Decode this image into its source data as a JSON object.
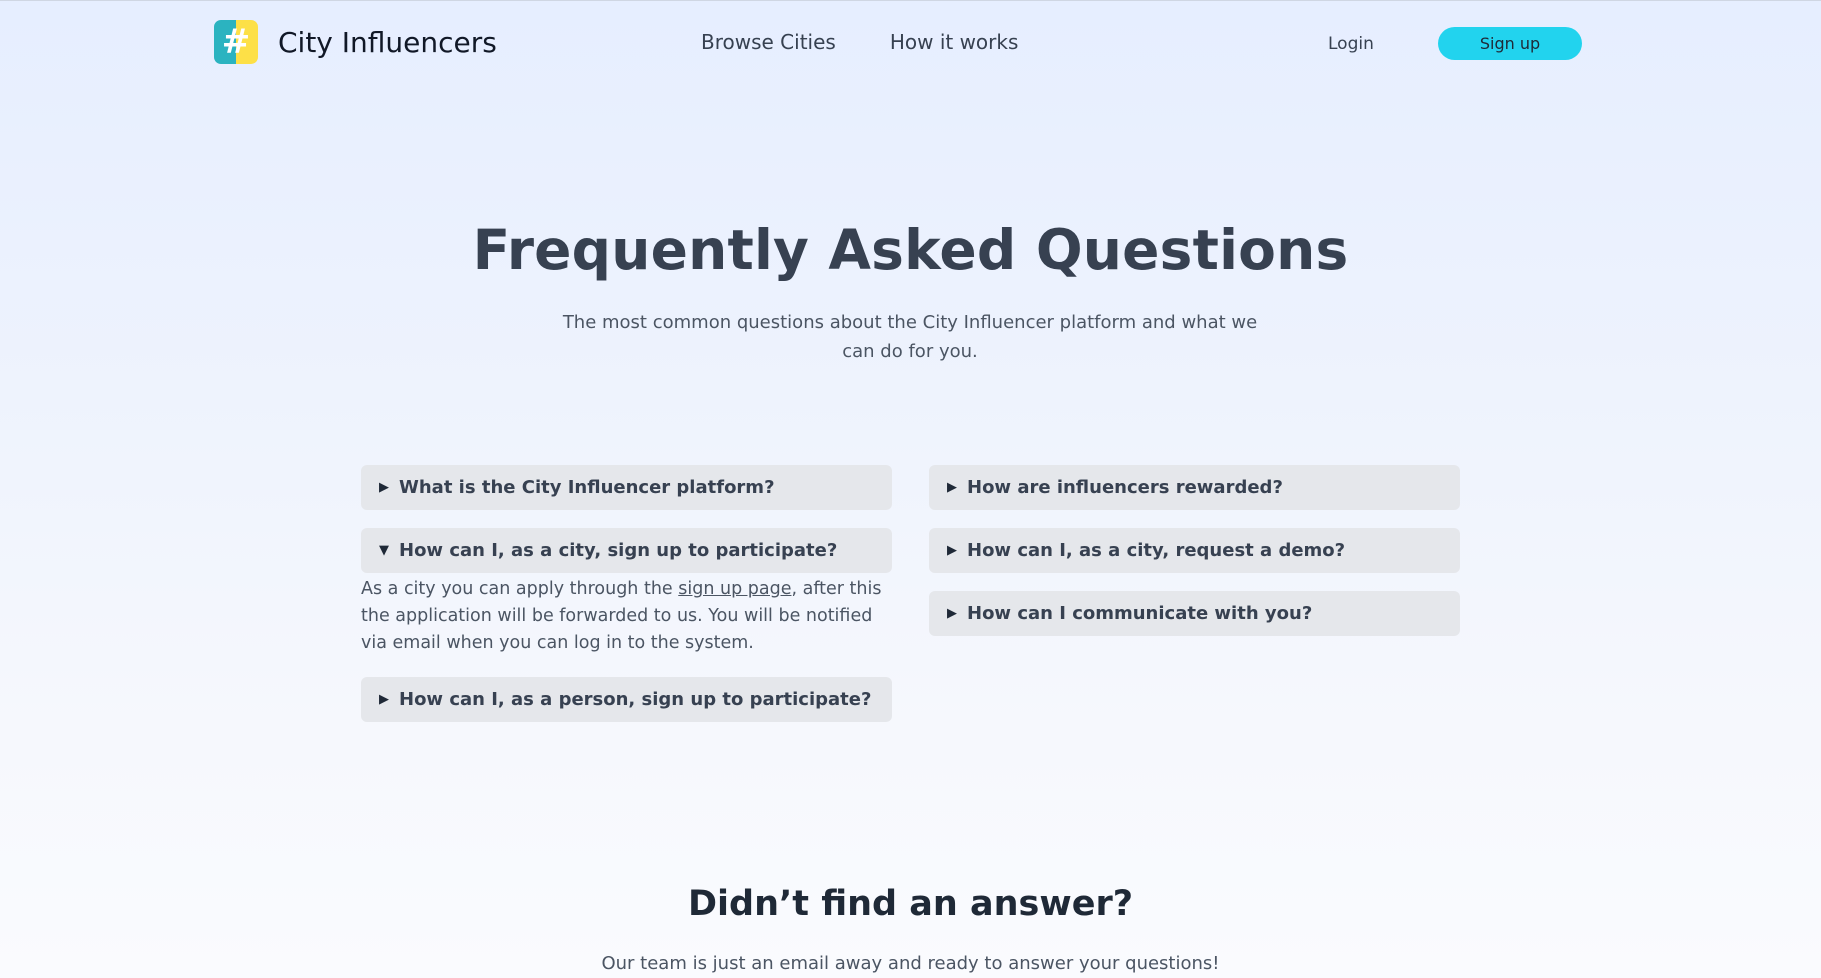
{
  "header": {
    "logo_glyph": "#",
    "brand": "City Influencers",
    "nav": [
      {
        "label": "Browse Cities"
      },
      {
        "label": "How it works"
      }
    ],
    "login": "Login",
    "signup": "Sign up",
    "colors": {
      "accent": "#22d3ee",
      "logo_left": "#2bb3c0",
      "logo_right": "#fde047"
    }
  },
  "hero": {
    "title": "Frequently Asked Questions",
    "subtitle": "The most common questions about the City Influencer platform and what we can do for you."
  },
  "faq": {
    "left": [
      {
        "question": "What is the City Influencer platform?",
        "icon": "triangle-right-icon"
      },
      {
        "question": "How can I, as a city, sign up to participate?",
        "icon": "triangle-down-icon",
        "answer_pre": "As a city you can apply through the ",
        "answer_link": "sign up page",
        "answer_post": ", after this the application will be forwarded to us. You will be notified via email when you can log in to the system."
      },
      {
        "question": "How can I, as a person, sign up to participate?",
        "icon": "triangle-right-icon"
      }
    ],
    "right": [
      {
        "question": "How are influencers rewarded?",
        "icon": "triangle-right-icon"
      },
      {
        "question": "How can I, as a city, request a demo?",
        "icon": "triangle-right-icon"
      },
      {
        "question": "How can I communicate with you?",
        "icon": "triangle-right-icon"
      }
    ]
  },
  "contact": {
    "title": "Didn’t find an answer?",
    "subtitle": "Our team is just an email away and ready to answer your questions!"
  }
}
